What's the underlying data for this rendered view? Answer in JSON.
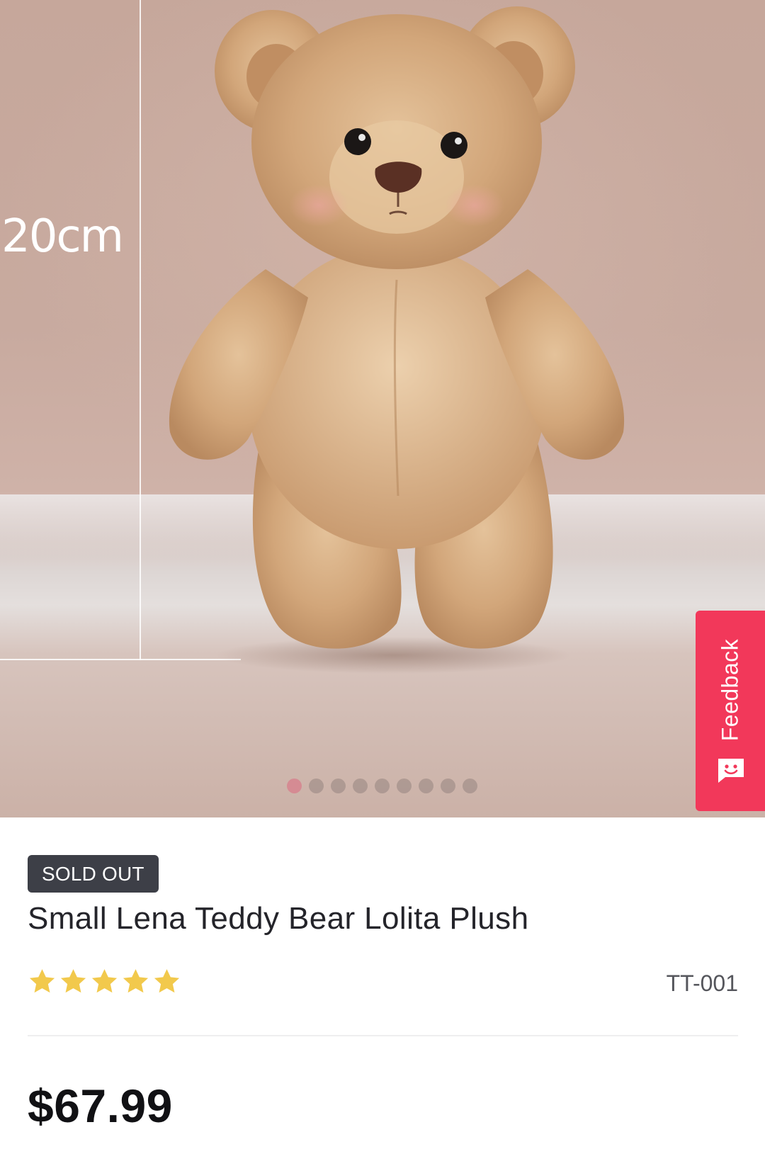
{
  "gallery": {
    "measurement_label": "20cm",
    "slide_count": 9,
    "active_slide": 1,
    "active_dot_color": "#d58b93",
    "image_subject": "teddy-bear-photo"
  },
  "feedback_tab": {
    "label": "Feedback",
    "color": "#f2385a",
    "icon": "smile-chat-icon"
  },
  "product": {
    "status_badge": "SOLD OUT",
    "title": "Small Lena Teddy Bear Lolita Plush",
    "rating": 5,
    "rating_max": 5,
    "star_color": "#f2c94c",
    "sku": "TT-001",
    "price": "$67.99"
  }
}
